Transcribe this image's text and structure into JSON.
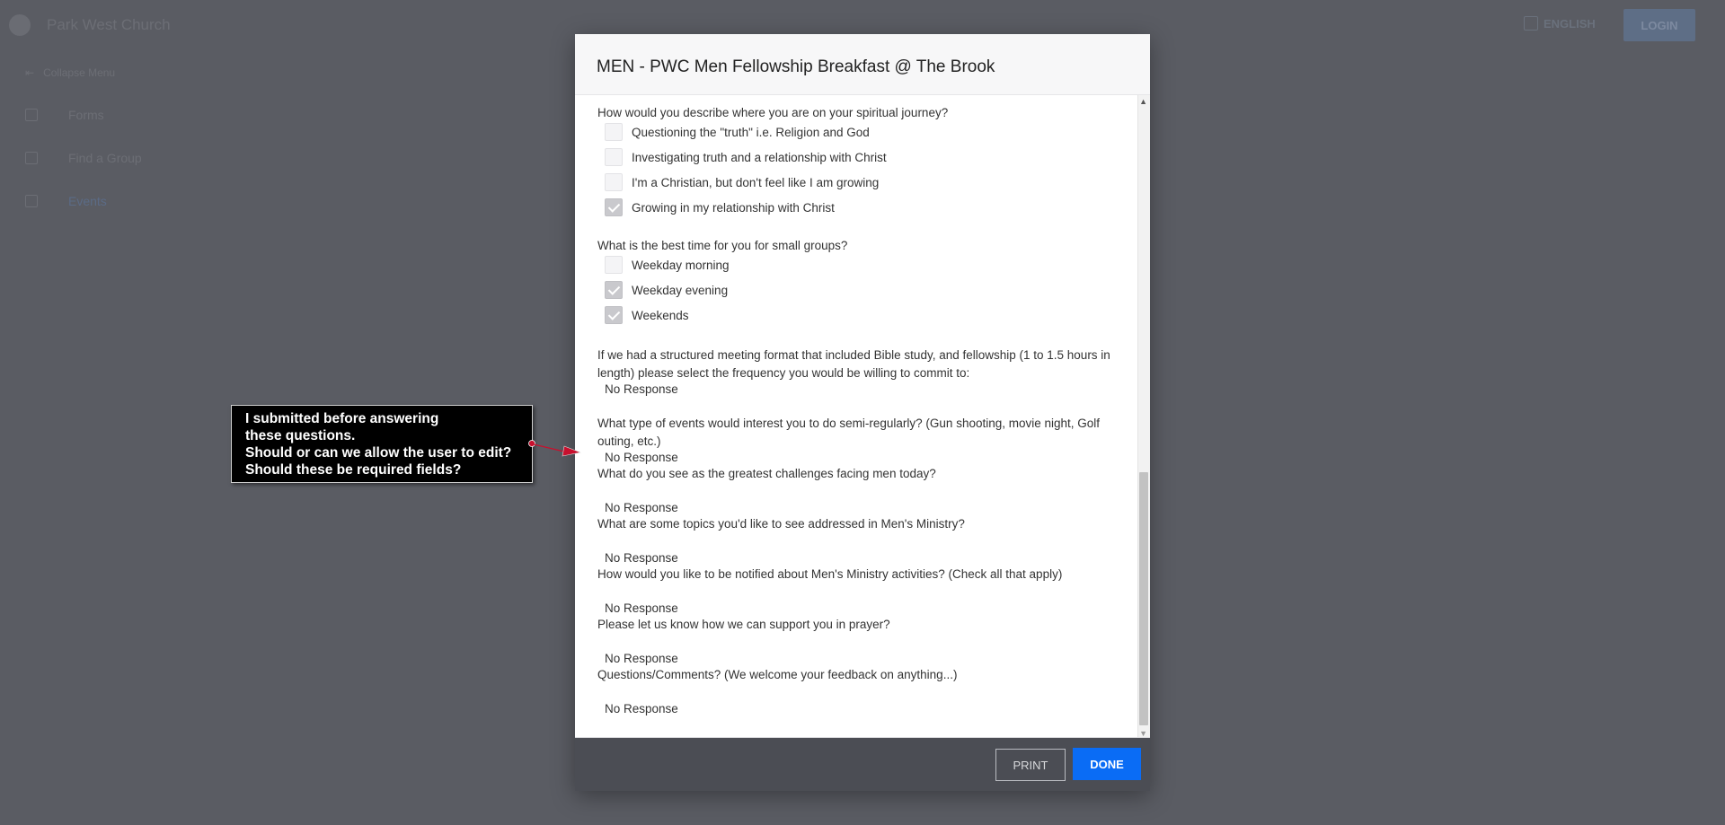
{
  "background": {
    "site_title": "Park West Church",
    "language_label": "ENGLISH",
    "login_label": "LOGIN",
    "nav_toggle_label": "Collapse Menu",
    "nav_items": [
      {
        "label": "Forms",
        "icon": "forms-icon"
      },
      {
        "label": "Find a Group",
        "icon": "group-icon"
      },
      {
        "label": "Events",
        "icon": "calendar-icon"
      }
    ]
  },
  "modal": {
    "title": "MEN - PWC Men Fellowship Breakfast @ The Brook",
    "questions": [
      {
        "text": "How would you describe where you are on your spiritual journey?",
        "options": [
          {
            "label": "Questioning the \"truth\" i.e. Religion and God",
            "checked": false
          },
          {
            "label": "Investigating truth and a relationship with Christ",
            "checked": false
          },
          {
            "label": "I'm a Christian, but don't feel like I am growing",
            "checked": false
          },
          {
            "label": "Growing in my relationship with Christ",
            "checked": true
          }
        ]
      },
      {
        "text": "What is the best time for you for small groups?",
        "options": [
          {
            "label": "Weekday morning",
            "checked": false
          },
          {
            "label": "Weekday evening",
            "checked": true
          },
          {
            "label": "Weekends",
            "checked": true
          }
        ]
      },
      {
        "text": "If we had a structured meeting format that included Bible study, and fellowship (1 to 1.5 hours in length) please select the frequency you would be willing to commit to:",
        "response": "No Response"
      },
      {
        "text": "What type of events would interest you to do semi-regularly? (Gun shooting, movie night, Golf outing, etc.)",
        "response": "No Response"
      },
      {
        "text": "What do you see as the greatest challenges facing men today?",
        "response": "No Response"
      },
      {
        "text": "What are some topics you'd like to see addressed in Men's Ministry?",
        "response": "No Response"
      },
      {
        "text": "How would you like to be notified about Men's Ministry activities? (Check all that apply)",
        "response": "No Response"
      },
      {
        "text": "Please let us know how we can support you in prayer?",
        "response": "No Response"
      },
      {
        "text": "Questions/Comments? (We welcome your feedback on anything...)",
        "response": "No Response"
      }
    ],
    "print_label": "PRINT",
    "done_label": "DONE"
  },
  "annotation": {
    "lines": [
      "I submitted before answering",
      "these questions.",
      "Should or can we allow the user to edit?",
      "Should these be required fields?"
    ],
    "arrow_color": "#c8102e"
  },
  "colors": {
    "primary": "#0a6cf5",
    "overlay": "#5a5c63",
    "footer": "#4b4d54"
  }
}
